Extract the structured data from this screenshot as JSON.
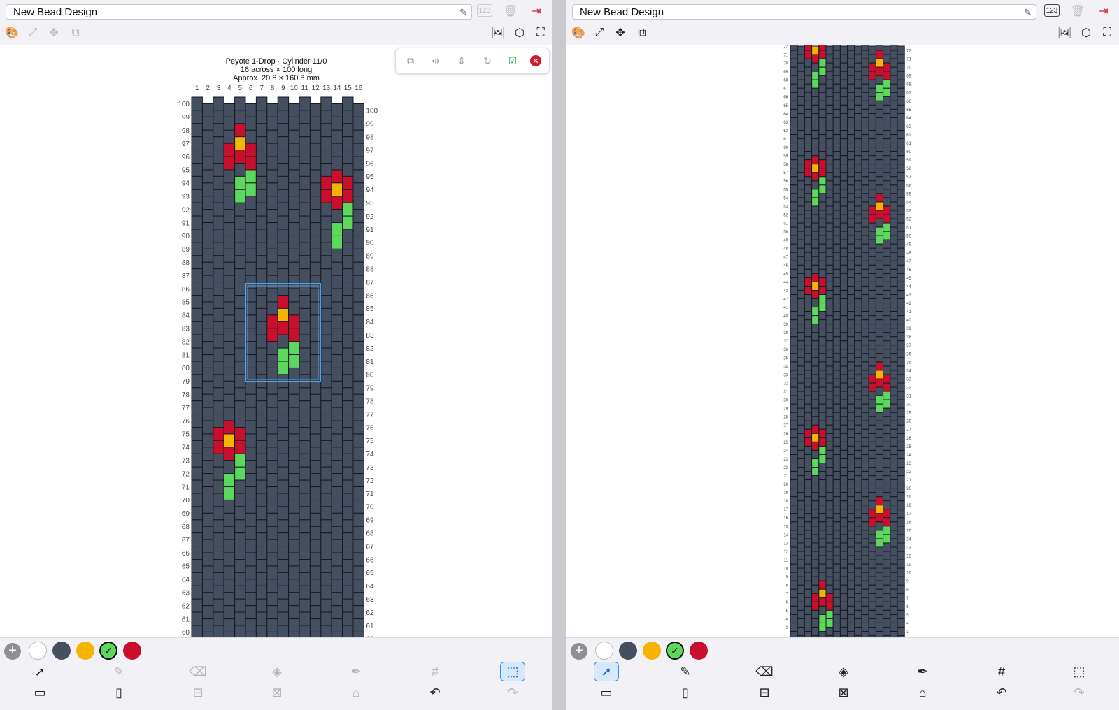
{
  "document_title": "New Bead Design",
  "toolbar": {
    "row1_icons": [
      "edit-title-icon",
      "bead-count-icon",
      "delete-icon",
      "exit-icon"
    ],
    "row2_icons": [
      "palette-icon",
      "resize-icon",
      "move-icon",
      "copy-layout-icon",
      "export-image-icon",
      "3d-view-icon",
      "fit-screen-icon"
    ],
    "count_label": "123"
  },
  "chart_header": {
    "line1": "Peyote 1-Drop · Cylinder 11/0",
    "line2": "16 across × 100 long",
    "line3": "Approx. 20.8 × 160.8 mm"
  },
  "pattern": {
    "columns": 16,
    "rows": 100,
    "visible_rows_left": [
      60,
      100
    ],
    "visible_rows_right": [
      3,
      72
    ],
    "column_labels": [
      "1",
      "2",
      "3",
      "4",
      "5",
      "6",
      "7",
      "8",
      "9",
      "10",
      "11",
      "12",
      "13",
      "14",
      "15",
      "16"
    ]
  },
  "selection_panel": {
    "icons": [
      "copy-icon",
      "flip-horizontal-icon",
      "flip-vertical-icon",
      "rotate-icon",
      "apply-icon",
      "close-icon"
    ]
  },
  "palette": {
    "colors": [
      "#ffffff",
      "#454f60",
      "#f4b400",
      "#5cd85c",
      "#c8102e"
    ],
    "selected_index": 3,
    "add_label": "+"
  },
  "tools": {
    "row1": [
      "select-tool",
      "pencil-tool",
      "eraser-tool",
      "fill-tool",
      "eyedropper-tool",
      "grid-tool",
      "selection-tool"
    ],
    "row2": [
      "add-row-tool",
      "add-column-tool",
      "delete-row-tool",
      "delete-column-tool",
      "brush-tool",
      "undo-tool",
      "redo-tool"
    ]
  },
  "colors": {
    "bead_base": "#454f60",
    "bead_outline": "#161a22",
    "petal": "#c8102e",
    "center": "#f4b400",
    "stem": "#5cd85c",
    "selection": "#4ea3ec"
  }
}
